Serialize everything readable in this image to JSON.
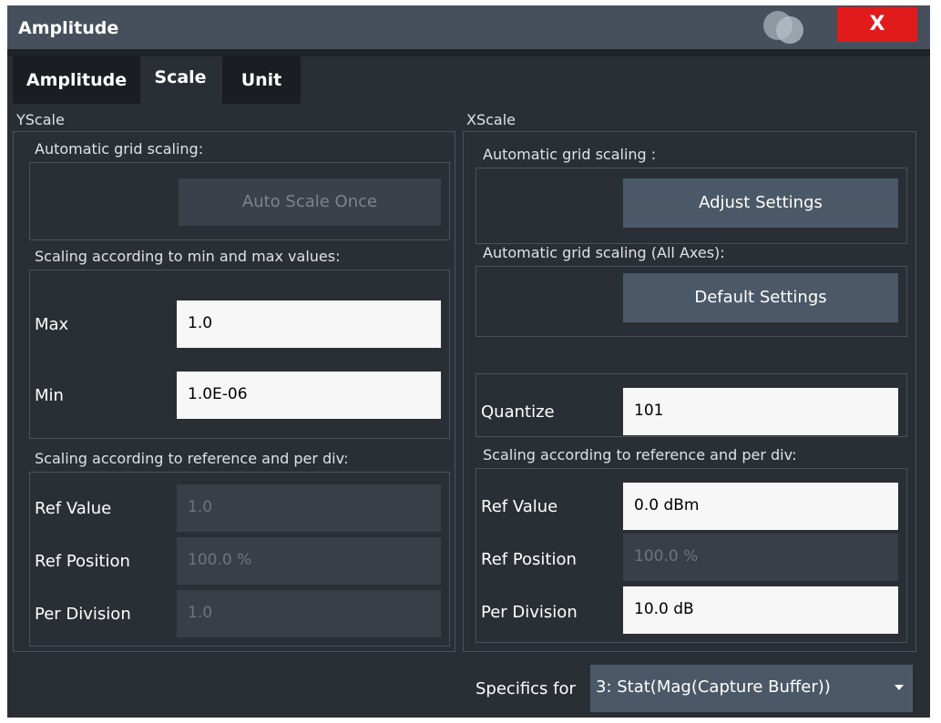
{
  "window": {
    "title": "Amplitude",
    "close_label": "X"
  },
  "tabs": [
    {
      "label": "Amplitude",
      "active": false
    },
    {
      "label": "Scale",
      "active": true
    },
    {
      "label": "Unit",
      "active": false
    }
  ],
  "yscale": {
    "label": "YScale",
    "auto_grid_label": "Automatic grid scaling:",
    "auto_scale_once": "Auto Scale Once",
    "minmax_label": "Scaling according to min and max values:",
    "max_label": "Max",
    "max_value": "1.0",
    "min_label": "Min",
    "min_value": "1.0E-06",
    "ref_div_label": "Scaling according to reference and per div:",
    "ref_value_label": "Ref Value",
    "ref_value": "1.0",
    "ref_position_label": "Ref Position",
    "ref_position": "100.0 %",
    "per_division_label": "Per Division",
    "per_division": "1.0"
  },
  "xscale": {
    "label": "XScale",
    "auto_grid_label": "Automatic grid scaling :",
    "adjust_settings": "Adjust Settings",
    "auto_grid_all_label": "Automatic grid scaling (All Axes):",
    "default_settings": "Default Settings",
    "quantize_label": "Quantize",
    "quantize_value": "101",
    "ref_div_label": "Scaling according to reference and per div:",
    "ref_value_label": "Ref Value",
    "ref_value": "0.0 dBm",
    "ref_position_label": "Ref Position",
    "ref_position": "100.0 %",
    "per_division_label": "Per Division",
    "per_division": "10.0 dB"
  },
  "specifics": {
    "label": "Specifics for",
    "selected": "3: Stat(Mag(Capture Buffer))"
  },
  "colors": {
    "close": "#e11b1b",
    "button": "#4b5867",
    "background": "#2a2f35"
  }
}
